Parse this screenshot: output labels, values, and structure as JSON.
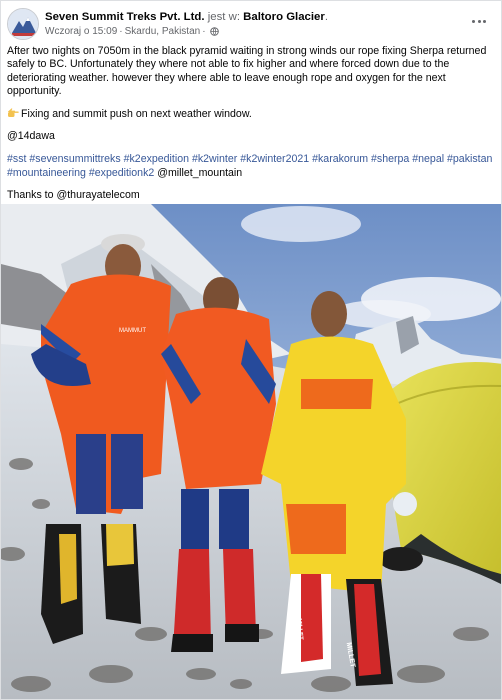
{
  "post": {
    "author": "Seven Summit Treks Pvt. Ltd.",
    "relation": "jest w:",
    "place": "Baltoro Glacier",
    "time": "Wczoraj o 15:09",
    "location": "Skardu, Pakistan",
    "paragraph1": "After two nights on 7050m in the black pyramid waiting in strong winds our rope fixing Sherpa returned safely to BC. Unfortunately they where not able to fix higher and where forced down due to the deteriorating weather. however they where able to leave enough rope and oxygen for the next opportunity.",
    "paragraph2": "Fixing and summit push on next weather window.",
    "mention1": "@14dawa",
    "hashtags": [
      "#sst",
      "#sevensummittreks",
      "#k2expedition",
      "#k2winter",
      "#k2winter2021",
      "#karakorum",
      "#sherpa",
      "#nepal",
      "#pakistan",
      "#mountaineering",
      "#expeditionk2"
    ],
    "mention2": "@millet_mountain",
    "thanks_prefix": "Thanks to",
    "thanks_mention": "@thurayatelecom",
    "jacket_brand": "MAMMUT",
    "boot_brand": "MILLET"
  },
  "icons": {
    "avatar": "company-logo-avatar",
    "globe": "globe-icon",
    "more": "more-options-icon",
    "hand": "pointing-hand-emoji"
  },
  "colors": {
    "link": "#385898",
    "muted": "#65676b",
    "text": "#050505"
  }
}
